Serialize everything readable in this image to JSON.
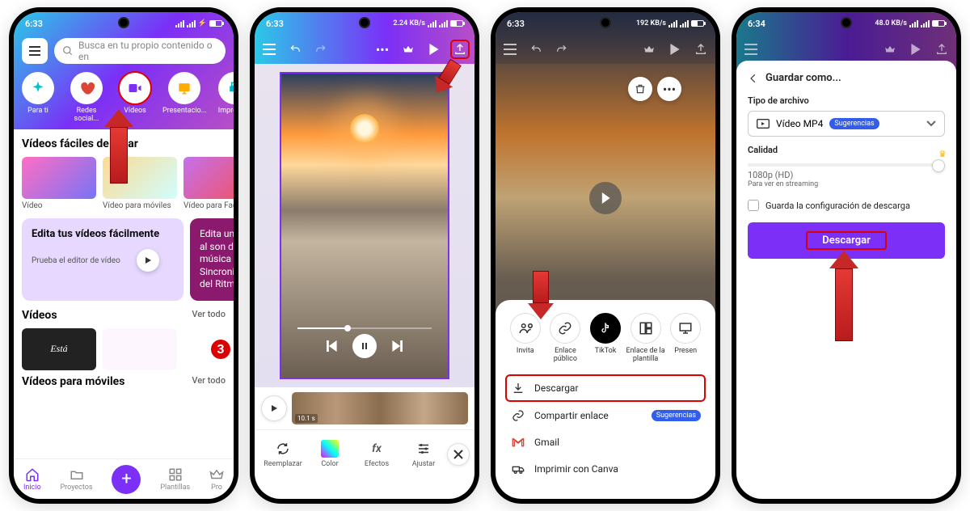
{
  "status": {
    "t1": "6:33",
    "t2": "6:33",
    "t3": "6:33",
    "t4": "6:34",
    "net": "2.24 KB/s",
    "net2": "192 KB/s",
    "net3": "48.0 KB/s"
  },
  "p1": {
    "search_placeholder": "Busca en tu propio contenido o en",
    "cats": [
      "Para ti",
      "Redes social...",
      "Vídeos",
      "Presentacio...",
      "Impresión"
    ],
    "sec1": "Vídeos fáciles de crear",
    "thumbs": [
      "Vídeo",
      "Vídeo para móviles",
      "Vídeo para Fac"
    ],
    "card1_title": "Edita tus vídeos fácilmente",
    "card1_sub": "Prueba el editor de vídeo",
    "card2": "Edita un v\nal son de\nmúsica c\nSincroniz\ndel Ritmo",
    "sec2": "Vídeos",
    "see_all": "Ver todo",
    "sec3": "Vídeos para móviles",
    "nav": [
      "Inicio",
      "Proyectos",
      "Plantillas",
      "Pro"
    ]
  },
  "p2": {
    "timeline_time": "10.1 s",
    "tools": [
      "Reemplazar",
      "Color",
      "Efectos",
      "Ajustar"
    ]
  },
  "p3": {
    "share": [
      "Invita",
      "Enlace público",
      "TikTok",
      "Enlace de la plantilla",
      "Presen"
    ],
    "download": "Descargar",
    "share_link": "Compartir enlace",
    "suggestions": "Sugerencias",
    "gmail": "Gmail",
    "print": "Imprimir con Canva"
  },
  "p4": {
    "title": "Guardar como...",
    "filetype_label": "Tipo de archivo",
    "filetype_value": "Vídeo MP4",
    "filetype_badge": "Sugerencias",
    "quality_label": "Calidad",
    "quality_value": "1080p (HD)",
    "quality_sub": "Para ver en streaming",
    "save_config": "Guarda la configuración de descarga",
    "download_btn": "Descargar"
  }
}
